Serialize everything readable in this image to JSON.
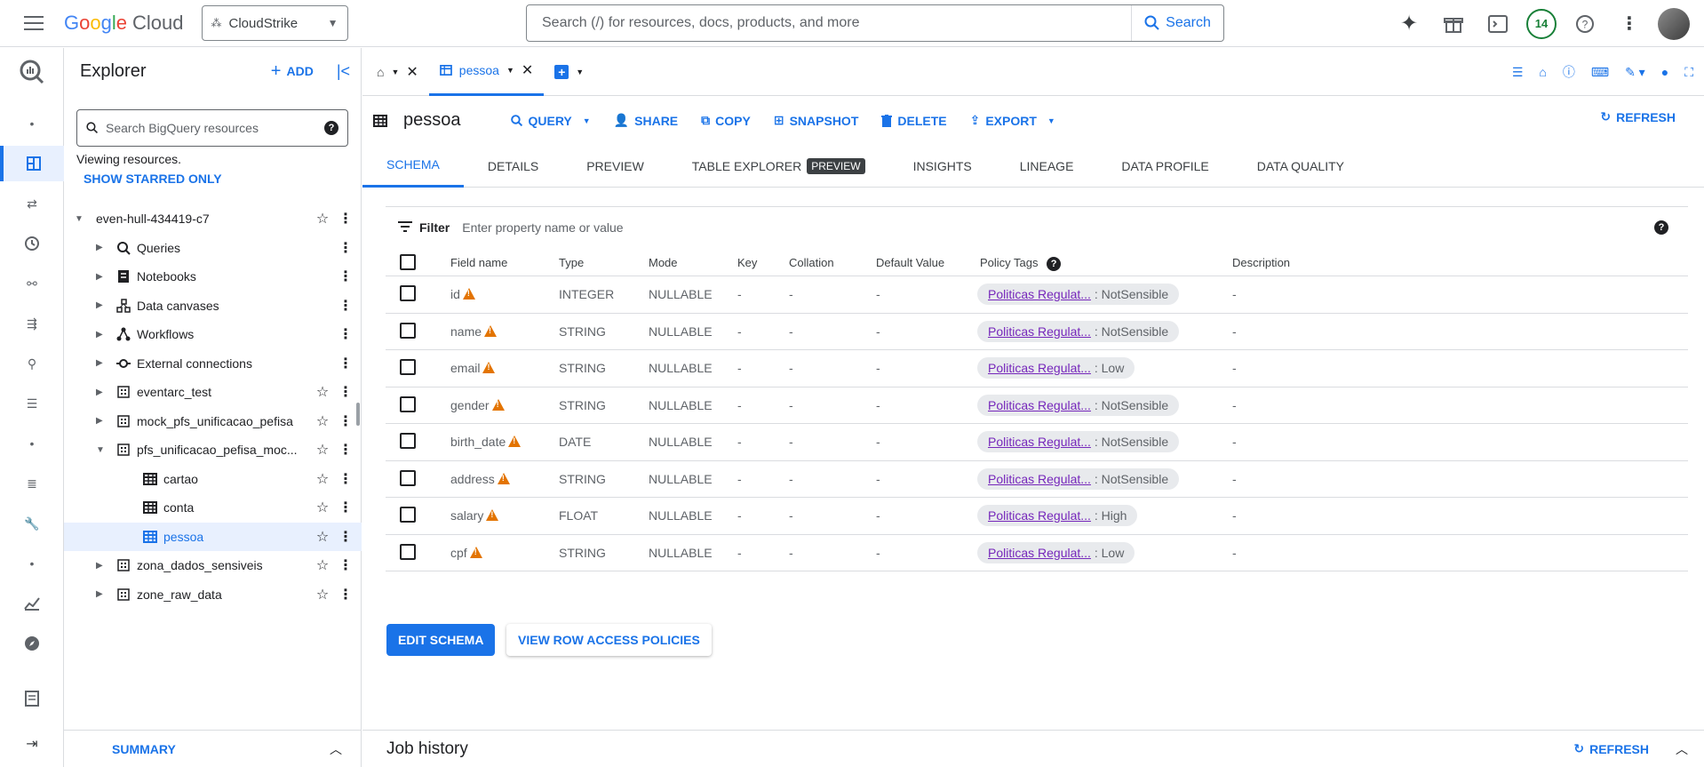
{
  "topbar": {
    "project": "CloudStrike",
    "search_placeholder": "Search (/) for resources, docs, products, and more",
    "search_button": "Search",
    "notification_count": "14"
  },
  "explorer": {
    "title": "Explorer",
    "add_label": "ADD",
    "search_placeholder": "Search BigQuery resources",
    "viewing_text": "Viewing resources.",
    "starred_link": "SHOW STARRED ONLY",
    "tree": [
      {
        "label": "even-hull-434419-c7"
      },
      {
        "label": "Queries"
      },
      {
        "label": "Notebooks"
      },
      {
        "label": "Data canvases"
      },
      {
        "label": "Workflows"
      },
      {
        "label": "External connections"
      },
      {
        "label": "eventarc_test"
      },
      {
        "label": "mock_pfs_unificacao_pefisa"
      },
      {
        "label": "pfs_unificacao_pefisa_moc..."
      },
      {
        "label": "cartao"
      },
      {
        "label": "conta"
      },
      {
        "label": "pessoa"
      },
      {
        "label": "zona_dados_sensiveis"
      },
      {
        "label": "zone_raw_data"
      }
    ],
    "summary_label": "SUMMARY"
  },
  "tabs": {
    "active_tab": "pessoa"
  },
  "table": {
    "name": "pessoa",
    "actions": {
      "query": "QUERY",
      "share": "SHARE",
      "copy": "COPY",
      "snapshot": "SNAPSHOT",
      "delete": "DELETE",
      "export": "EXPORT",
      "refresh": "REFRESH"
    },
    "subtabs": [
      "SCHEMA",
      "DETAILS",
      "PREVIEW",
      "TABLE EXPLORER",
      "INSIGHTS",
      "LINEAGE",
      "DATA PROFILE",
      "DATA QUALITY"
    ],
    "preview_chip": "PREVIEW"
  },
  "schema": {
    "filter_label": "Filter",
    "filter_placeholder": "Enter property name or value",
    "headers": {
      "field_name": "Field name",
      "type": "Type",
      "mode": "Mode",
      "key": "Key",
      "collation": "Collation",
      "default_value": "Default Value",
      "policy_tags": "Policy Tags",
      "description": "Description"
    },
    "rows": [
      {
        "field": "id",
        "type": "INTEGER",
        "mode": "NULLABLE",
        "key": "-",
        "collation": "-",
        "default": "-",
        "tag_link": "Politicas Regulat...",
        "tag_value": " : NotSensible",
        "description": "-"
      },
      {
        "field": "name",
        "type": "STRING",
        "mode": "NULLABLE",
        "key": "-",
        "collation": "-",
        "default": "-",
        "tag_link": "Politicas Regulat...",
        "tag_value": " : NotSensible",
        "description": "-"
      },
      {
        "field": "email",
        "type": "STRING",
        "mode": "NULLABLE",
        "key": "-",
        "collation": "-",
        "default": "-",
        "tag_link": "Politicas Regulat...",
        "tag_value": " : Low",
        "description": "-"
      },
      {
        "field": "gender",
        "type": "STRING",
        "mode": "NULLABLE",
        "key": "-",
        "collation": "-",
        "default": "-",
        "tag_link": "Politicas Regulat...",
        "tag_value": " : NotSensible",
        "description": "-"
      },
      {
        "field": "birth_date",
        "type": "DATE",
        "mode": "NULLABLE",
        "key": "-",
        "collation": "-",
        "default": "-",
        "tag_link": "Politicas Regulat...",
        "tag_value": " : NotSensible",
        "description": "-"
      },
      {
        "field": "address",
        "type": "STRING",
        "mode": "NULLABLE",
        "key": "-",
        "collation": "-",
        "default": "-",
        "tag_link": "Politicas Regulat...",
        "tag_value": " : NotSensible",
        "description": "-"
      },
      {
        "field": "salary",
        "type": "FLOAT",
        "mode": "NULLABLE",
        "key": "-",
        "collation": "-",
        "default": "-",
        "tag_link": "Politicas Regulat...",
        "tag_value": " : High",
        "description": "-"
      },
      {
        "field": "cpf",
        "type": "STRING",
        "mode": "NULLABLE",
        "key": "-",
        "collation": "-",
        "default": "-",
        "tag_link": "Politicas Regulat...",
        "tag_value": " : Low",
        "description": "-"
      }
    ],
    "edit_button": "EDIT SCHEMA",
    "row_access_button": "VIEW ROW ACCESS POLICIES"
  },
  "job_history": {
    "title": "Job history",
    "refresh": "REFRESH"
  },
  "colors": {
    "accent": "#1a73e8",
    "warning": "#e37400",
    "tag_link": "#7627bb"
  }
}
